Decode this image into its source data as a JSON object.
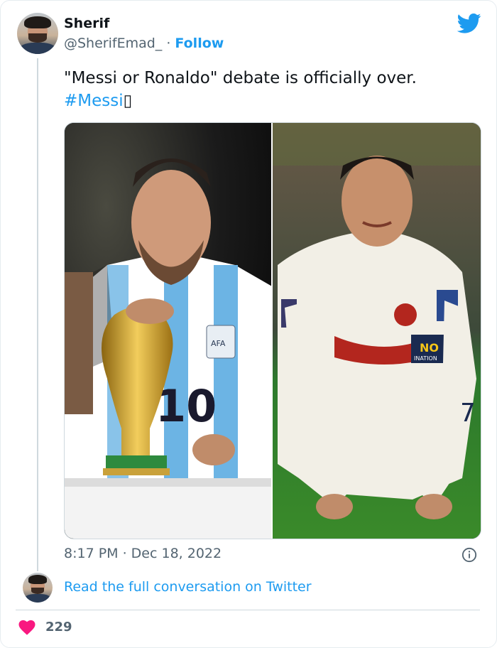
{
  "author": {
    "name": "Sherif",
    "handle": "@SherifEmad_",
    "separator": " · ",
    "follow_label": "Follow"
  },
  "tweet": {
    "text": "\"Messi or Ronaldo\" debate is officially over.",
    "hashtag": "#Messi",
    "emoji_glyph": "▯",
    "timestamp": "8:17 PM · Dec 18, 2022"
  },
  "media": {
    "left_jersey_number": "10",
    "left_badge_text": "AFA",
    "right_armband_text": "NO",
    "right_armband_subtext": "INATION",
    "right_shorts_number": "7"
  },
  "footer": {
    "read_link": "Read the full conversation on Twitter",
    "like_count": "229"
  },
  "icons": {
    "brand": "twitter-bird-icon",
    "info": "info-icon",
    "like": "heart-icon"
  },
  "colors": {
    "accent": "#1d9bf0",
    "heart": "#f91880",
    "secondary_text": "#536471",
    "border": "#cfd9de"
  }
}
